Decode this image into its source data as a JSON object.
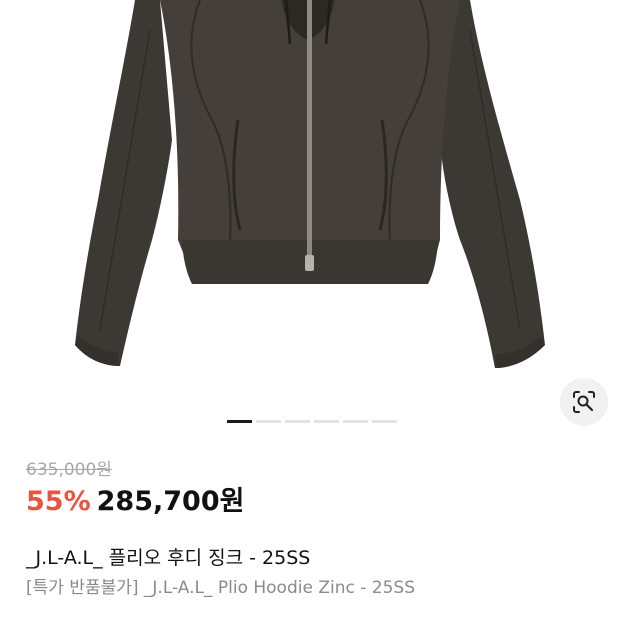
{
  "product": {
    "image_alt": "zip-up hoodie jacket",
    "image_count": 6,
    "active_image_index": 0,
    "original_price": "635,000원",
    "discount": "55%",
    "sale_price": "285,700원",
    "name": "_J.L-A.L_ 플리오 후디 징크 - 25SS",
    "subname": "[특가 반품불가] _J.L-A.L_ Plio Hoodie Zinc - 25SS"
  },
  "colors": {
    "discount": "#e8543f",
    "garment": "#403c37",
    "pager_active": "#1a1a1a",
    "pager_inactive": "#e4e4e4"
  },
  "icons": {
    "lens": "lens-search-icon"
  }
}
